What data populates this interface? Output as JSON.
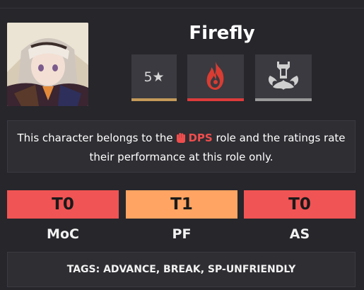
{
  "character": {
    "name": "Firefly",
    "rarity": "5★",
    "element_icon": "fire-element-icon",
    "path_icon": "destruction-path-icon"
  },
  "role_info": {
    "prefix": "This character belongs to the",
    "role": "DPS",
    "suffix": "role and the ratings rate their performance at this role only.",
    "role_icon": "fist-icon"
  },
  "ratings": [
    {
      "mode": "MoC",
      "tier": "T0",
      "color": "#f05454"
    },
    {
      "mode": "PF",
      "tier": "T1",
      "color": "#ffa462"
    },
    {
      "mode": "AS",
      "tier": "T0",
      "color": "#f05454"
    }
  ],
  "tags": {
    "text": "TAGS: ADVANCE, BREAK, SP-UNFRIENDLY"
  },
  "colors": {
    "background": "#26262b",
    "rarity_bar": "#c49a5a",
    "element_bar": "#dd3b3b",
    "path_bar": "#9a9a9a",
    "dps_red": "#ef4d4d"
  }
}
